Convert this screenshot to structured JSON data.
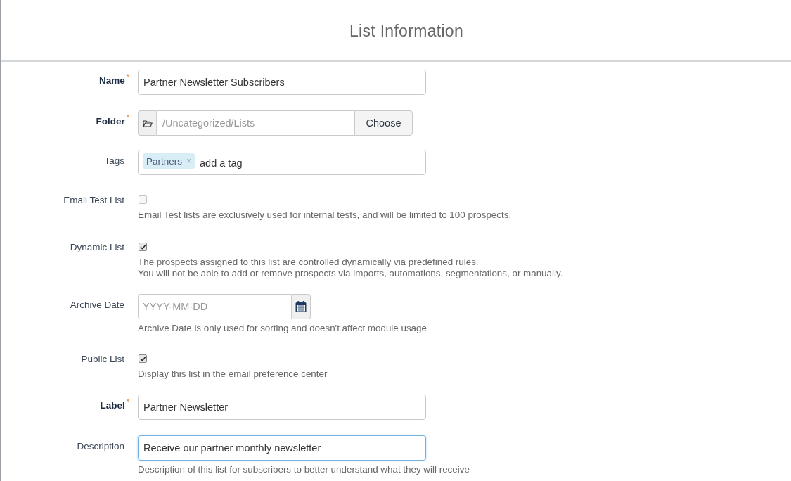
{
  "header": {
    "title": "List Information"
  },
  "fields": [
    {
      "kind": "text",
      "label": "Name",
      "required": true,
      "required_mark": "*",
      "value": "Partner Newsletter Subscribers",
      "focused": false
    },
    {
      "kind": "folder",
      "label": "Folder",
      "required": true,
      "required_mark": "*",
      "placeholder": "/Uncategorized/Lists",
      "button": "Choose"
    },
    {
      "kind": "tags",
      "label": "Tags",
      "required": false,
      "tags": [
        {
          "label": "Partners",
          "remove": "×"
        }
      ],
      "placeholder": "add a tag"
    },
    {
      "kind": "checkbox",
      "label": "Email Test List",
      "required": false,
      "checked": false,
      "help": [
        "Email Test lists are exclusively used for internal tests, and will be limited to 100 prospects."
      ]
    },
    {
      "kind": "checkbox",
      "label": "Dynamic List",
      "required": false,
      "checked": true,
      "help": [
        "The prospects assigned to this list are controlled dynamically via predefined rules.",
        "You will not be able to add or remove prospects via imports, automations, segmentations, or manually."
      ]
    },
    {
      "kind": "date",
      "label": "Archive Date",
      "required": false,
      "placeholder": "YYYY-MM-DD",
      "help": [
        "Archive Date is only used for sorting and doesn't affect module usage"
      ]
    },
    {
      "kind": "checkbox",
      "label": "Public List",
      "required": false,
      "checked": true,
      "help": [
        "Display this list in the email preference center"
      ]
    },
    {
      "kind": "text",
      "label": "Label",
      "required": true,
      "required_mark": "*",
      "value": "Partner Newsletter",
      "focused": false
    },
    {
      "kind": "text",
      "label": "Description",
      "required": false,
      "value": "Receive our partner monthly newsletter",
      "focused": true,
      "help": [
        "Description of this list for subscribers to better understand what they will receive"
      ]
    }
  ]
}
